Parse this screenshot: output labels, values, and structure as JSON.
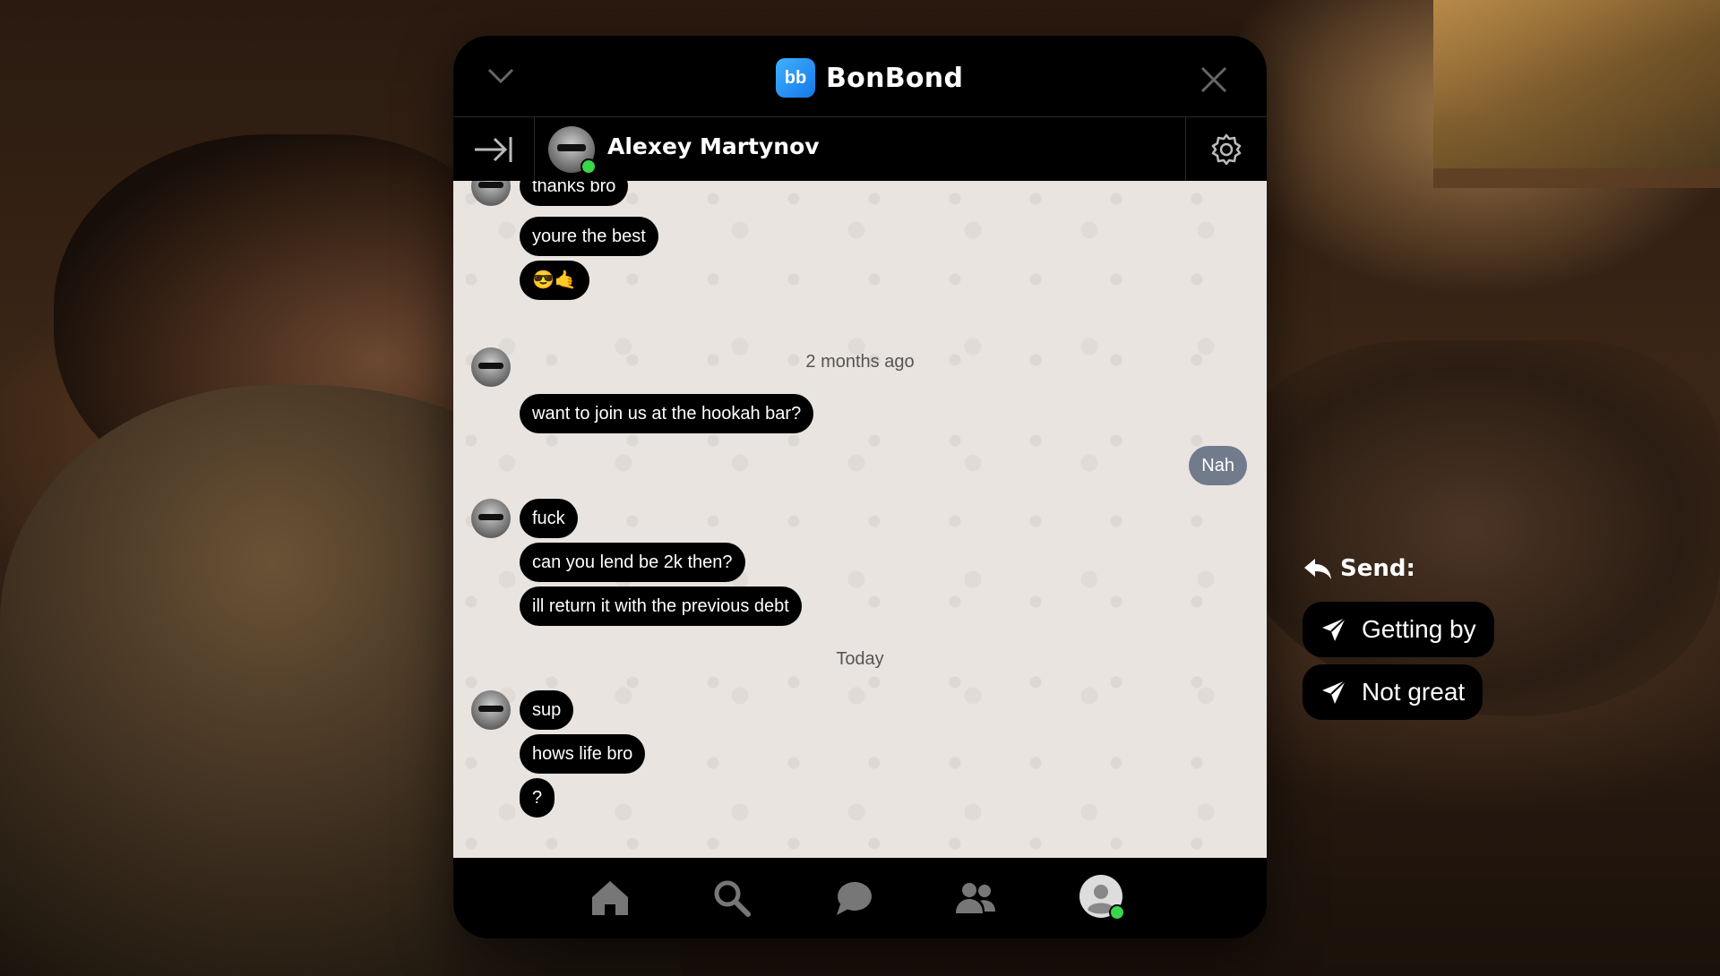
{
  "app": {
    "name": "BonBond",
    "logo_text": "bb"
  },
  "contact": {
    "name": "Alexey Martynov",
    "online": true
  },
  "chat": {
    "messages": [
      {
        "from": "them",
        "text": "thanks bro"
      },
      {
        "from": "them",
        "text": "youre the best"
      },
      {
        "from": "them",
        "text": "😎🤙"
      },
      {
        "type": "date",
        "text": "2 months ago"
      },
      {
        "from": "them",
        "text": "want to join us at the hookah bar?"
      },
      {
        "from": "me",
        "text": "Nah"
      },
      {
        "from": "them",
        "text": "fuck"
      },
      {
        "from": "them",
        "text": "can you lend be 2k then?"
      },
      {
        "from": "them",
        "text": "ill return it with the previous debt"
      },
      {
        "type": "date",
        "text": "Today"
      },
      {
        "from": "them",
        "text": "sup"
      },
      {
        "from": "them",
        "text": "hows life bro"
      },
      {
        "from": "them",
        "text": "?"
      }
    ]
  },
  "nav": {
    "items": [
      "home-icon",
      "search-icon",
      "chat-icon",
      "friends-icon",
      "profile-icon"
    ]
  },
  "send": {
    "title": "Send:",
    "options": [
      "Getting by",
      "Not great"
    ]
  },
  "colors": {
    "chat_bg": "#e9e4e0",
    "bubble_them": "#000000",
    "bubble_me": "#727b8c",
    "online": "#3ad64a",
    "brand": "#1e8ef5"
  }
}
